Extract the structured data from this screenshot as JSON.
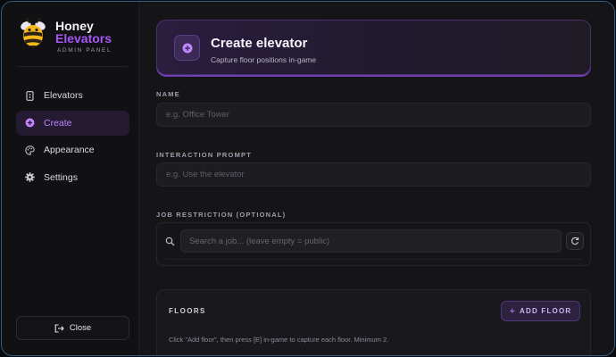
{
  "brand": {
    "line1": "Honey",
    "line2": "Elevators",
    "subtitle": "ADMIN PANEL"
  },
  "sidebar": {
    "items": [
      {
        "label": "Elevators",
        "icon": "elevator-icon",
        "active": false
      },
      {
        "label": "Create",
        "icon": "plus-circle-icon",
        "active": true
      },
      {
        "label": "Appearance",
        "icon": "palette-icon",
        "active": false
      },
      {
        "label": "Settings",
        "icon": "gear-icon",
        "active": false
      }
    ],
    "close_label": "Close"
  },
  "header": {
    "title": "Create elevator",
    "subtitle": "Capture floor positions in-game"
  },
  "form": {
    "name_label": "NAME",
    "name_placeholder": "e.g. Office Tower",
    "name_value": "",
    "prompt_label": "INTERACTION PROMPT",
    "prompt_placeholder": "e.g. Use the elevator",
    "prompt_value": "",
    "job_label": "JOB RESTRICTION (OPTIONAL)",
    "job_placeholder": "Search a job... (leave empty = public)",
    "job_value": ""
  },
  "floors": {
    "title": "FLOORS",
    "add_label": "ADD FLOOR",
    "help": "Click \"Add floor\", then press [E] in-game to capture each floor. Minimum 2."
  },
  "colors": {
    "accent": "#a855f7",
    "accent_soft": "#c084fc",
    "background": "#131316",
    "window_border": "#2e5f8a"
  }
}
